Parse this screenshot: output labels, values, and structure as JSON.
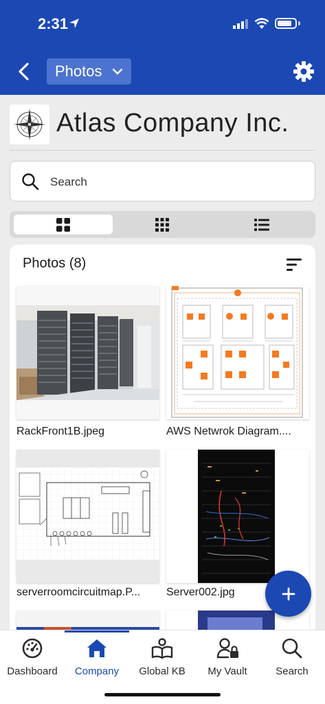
{
  "status": {
    "time": "2:31"
  },
  "nav": {
    "back": "back",
    "dropdown_label": "Photos",
    "settings": "settings"
  },
  "company": {
    "name": "Atlas Company Inc."
  },
  "search": {
    "placeholder": "Search"
  },
  "view_toggle": {
    "options": [
      "large-grid",
      "small-grid",
      "list"
    ],
    "selected": "large-grid"
  },
  "photos": {
    "title": "Photos (8)",
    "items": [
      {
        "label": "RackFront1B.jpeg"
      },
      {
        "label": "AWS Netwrok Diagram...."
      },
      {
        "label": "serverroomcircuitmap.P..."
      },
      {
        "label": "Server002.jpg"
      }
    ]
  },
  "tabs": [
    {
      "label": "Dashboard",
      "icon": "dashboard-icon"
    },
    {
      "label": "Company",
      "icon": "home-icon",
      "active": true
    },
    {
      "label": "Global KB",
      "icon": "book-icon"
    },
    {
      "label": "My Vault",
      "icon": "user-lock-icon"
    },
    {
      "label": "Search",
      "icon": "search-icon"
    }
  ],
  "colors": {
    "brand": "#1b48b3",
    "accent_orange": "#f47b20"
  }
}
